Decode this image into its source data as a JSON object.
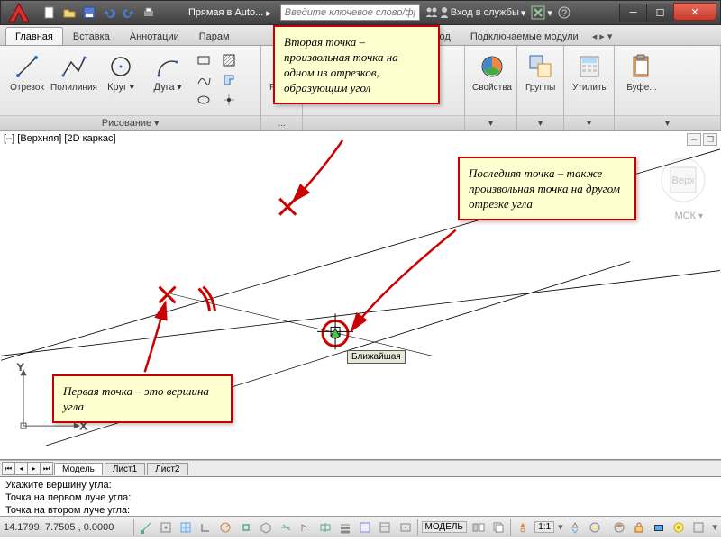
{
  "title": "Прямая в Auto...",
  "search_placeholder": "Введите ключевое слово/фразу",
  "login_label": "Вход в службы",
  "tabs": [
    "Главная",
    "Вставка",
    "Аннотации",
    "Парам",
    "",
    "Вывод",
    "Подключаемые модули"
  ],
  "active_tab": 0,
  "panels": {
    "draw": {
      "title": "Рисование",
      "buttons": {
        "line": "Отрезок",
        "polyline": "Полилиния",
        "circle": "Круг",
        "arc": "Дуга"
      }
    },
    "edit": {
      "title": "Редак..."
    },
    "props": {
      "title": "Свойства"
    },
    "groups": {
      "title": "Группы"
    },
    "util": {
      "title": "Утилиты"
    },
    "clip": {
      "title": "Буфе..."
    }
  },
  "viewport_label": "[–] [Верхняя] [2D каркас]",
  "mck_label": "МСК",
  "tooltip": "Ближайшая",
  "notes": {
    "n1": "Вторая точка – произвольная точка на одном из отрезков, образующим угол",
    "n2": "Последняя точка – также произвольная точка на другом отрезке угла",
    "n3": "Первая точка – это вершина угла"
  },
  "sheets": [
    "Модель",
    "Лист1",
    "Лист2"
  ],
  "cmd_lines": [
    "Укажите вершину угла:",
    "Точка на первом луче угла:",
    "Точка на втором луче угла:"
  ],
  "coords": "14.1799, 7.7505 , 0.0000",
  "model_btn": "МОДЕЛЬ",
  "scale": "1:1"
}
